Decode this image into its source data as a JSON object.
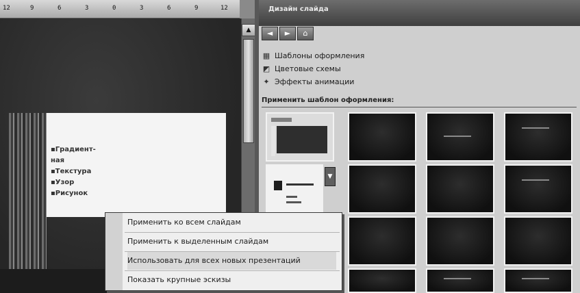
{
  "ruler": {
    "ticks": [
      "12",
      "9",
      "6",
      "3",
      "0",
      "3",
      "6",
      "9",
      "12"
    ]
  },
  "slide": {
    "bullets": [
      "▪Градиент-",
      "ная",
      "▪Текстура",
      "▪Узор",
      "▪Рисунок"
    ]
  },
  "scrollbar": {
    "up_arrow": "▲"
  },
  "task_pane": {
    "title": "Дизайн слайда",
    "nav": {
      "back": "◄",
      "forward": "►",
      "home": "⌂"
    },
    "links": [
      {
        "icon": "design-templates-icon",
        "glyph": "▦",
        "label": "Шаблоны оформления"
      },
      {
        "icon": "color-schemes-icon",
        "glyph": "◩",
        "label": "Цветовые схемы"
      },
      {
        "icon": "animation-effects-icon",
        "glyph": "✦",
        "label": "Эффекты анимации"
      }
    ],
    "section_title": "Применить шаблон оформления:",
    "dropdown_arrow": "▼"
  },
  "context_menu": {
    "items": [
      "Применить ко всем слайдам",
      "Применить к выделенным слайдам",
      "Использовать для всех новых презентаций",
      "Показать крупные эскизы"
    ]
  },
  "colors": {
    "accent": "#5a5a5a",
    "slide_bg": "#2b2b2b",
    "menu_bg": "#efefef"
  }
}
